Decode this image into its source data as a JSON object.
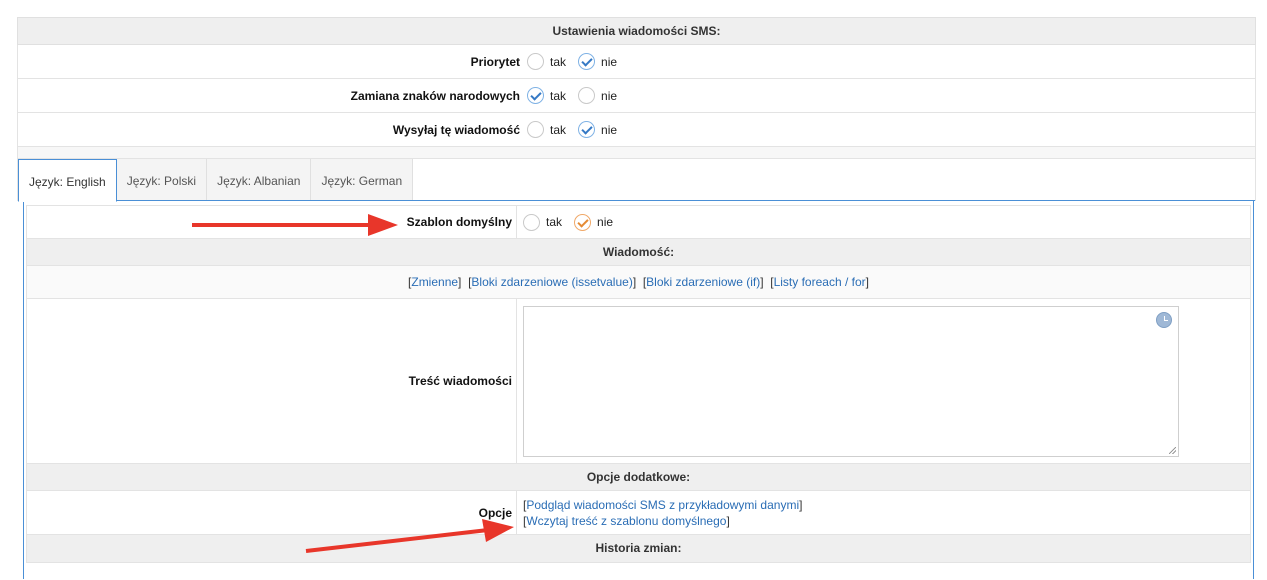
{
  "sms_settings": {
    "title": "Ustawienia wiadomości SMS:",
    "rows": [
      {
        "label": "Priorytet",
        "yes": "tak",
        "no": "nie",
        "selected": "nie"
      },
      {
        "label": "Zamiana znaków narodowych",
        "yes": "tak",
        "no": "nie",
        "selected": "tak"
      },
      {
        "label": "Wysyłaj tę wiadomość",
        "yes": "tak",
        "no": "nie",
        "selected": "nie"
      }
    ]
  },
  "tabs": [
    {
      "label": "Język: English",
      "active": true
    },
    {
      "label": "Język: Polski",
      "active": false
    },
    {
      "label": "Język: Albanian",
      "active": false
    },
    {
      "label": "Język: German",
      "active": false
    }
  ],
  "template_default": {
    "label": "Szablon domyślny",
    "yes": "tak",
    "no": "nie",
    "selected": "nie"
  },
  "message": {
    "title": "Wiadomość:",
    "links": [
      "Zmienne",
      "Bloki zdarzeniowe (issetvalue)",
      "Bloki zdarzeniowe (if)",
      "Listy foreach / for"
    ],
    "content_label": "Treść wiadomości",
    "content_value": ""
  },
  "extra_options": {
    "title": "Opcje dodatkowe:",
    "label": "Opcje",
    "links": [
      "Podgląd wiadomości SMS z przykładowymi danymi",
      "Wczytaj treść z szablonu domyślnego"
    ]
  },
  "history": {
    "title": "Historia zmian:"
  },
  "colors": {
    "accent": "#4a8fd6",
    "link": "#2a6db5",
    "arrow": "#e8362a",
    "check_blue": "#3579c5",
    "check_orange": "#e58a33"
  }
}
